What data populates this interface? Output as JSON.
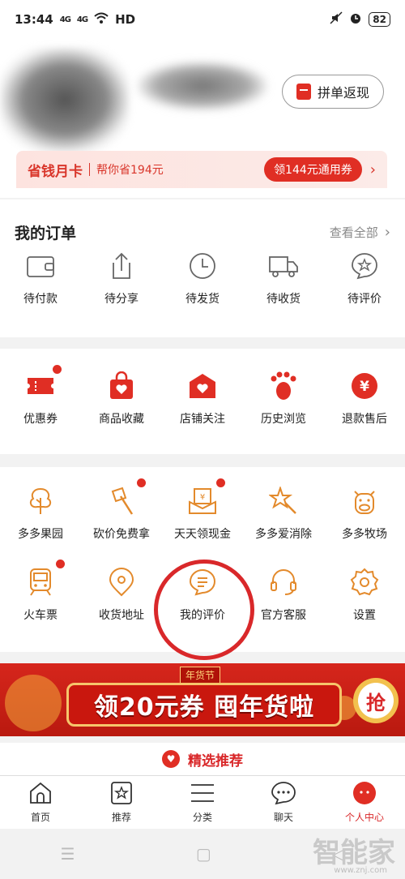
{
  "status": {
    "time": "13:44",
    "network": "HD",
    "battery": "82",
    "signal_labels": [
      "4G",
      "4G"
    ]
  },
  "profile": {
    "cashback_label": "拼单返现"
  },
  "saving_card": {
    "title": "省钱月卡",
    "subtitle": "帮你省194元",
    "coupon_label": "领144元通用券"
  },
  "orders": {
    "title": "我的订单",
    "view_all": "查看全部",
    "items": [
      {
        "label": "待付款",
        "icon": "wallet-icon"
      },
      {
        "label": "待分享",
        "icon": "share-icon"
      },
      {
        "label": "待发货",
        "icon": "clock-icon"
      },
      {
        "label": "待收货",
        "icon": "truck-icon"
      },
      {
        "label": "待评价",
        "icon": "review-star-icon"
      }
    ]
  },
  "utility": {
    "items": [
      {
        "label": "优惠券",
        "icon": "ticket-icon",
        "dot": true
      },
      {
        "label": "商品收藏",
        "icon": "bag-heart-icon",
        "dot": false
      },
      {
        "label": "店铺关注",
        "icon": "shop-heart-icon",
        "dot": false
      },
      {
        "label": "历史浏览",
        "icon": "footprint-icon",
        "dot": false
      },
      {
        "label": "退款售后",
        "icon": "yen-icon",
        "dot": false
      }
    ]
  },
  "tools": {
    "row1": [
      {
        "label": "多多果园",
        "icon": "tree-icon",
        "dot": false
      },
      {
        "label": "砍价免费拿",
        "icon": "axe-icon",
        "dot": true
      },
      {
        "label": "天天领现金",
        "icon": "cash-envelope-icon",
        "dot": true
      },
      {
        "label": "多多爱消除",
        "icon": "star-wand-icon",
        "dot": false
      },
      {
        "label": "多多牧场",
        "icon": "cow-icon",
        "dot": false
      }
    ],
    "row2": [
      {
        "label": "火车票",
        "icon": "train-icon",
        "dot": true
      },
      {
        "label": "收货地址",
        "icon": "location-icon",
        "dot": false
      },
      {
        "label": "我的评价",
        "icon": "comment-icon",
        "dot": false
      },
      {
        "label": "官方客服",
        "icon": "headset-icon",
        "dot": false
      },
      {
        "label": "设置",
        "icon": "gear-icon",
        "dot": false
      }
    ]
  },
  "promo": {
    "tag": "年货节",
    "text": "领20元券 囤年货啦",
    "button": "抢"
  },
  "picks": {
    "label": "精选推荐"
  },
  "tabbar": {
    "items": [
      {
        "label": "首页",
        "icon": "home-icon",
        "active": false
      },
      {
        "label": "推荐",
        "icon": "recommend-icon",
        "active": false
      },
      {
        "label": "分类",
        "icon": "list-icon",
        "active": false
      },
      {
        "label": "聊天",
        "icon": "chat-icon",
        "active": false
      },
      {
        "label": "个人中心",
        "icon": "profile-icon",
        "active": true
      }
    ]
  },
  "watermark": {
    "text": "智能家",
    "sub": "www.znj.com"
  },
  "colors": {
    "accent": "#e02e24",
    "orange_icon": "#e38a2c"
  }
}
